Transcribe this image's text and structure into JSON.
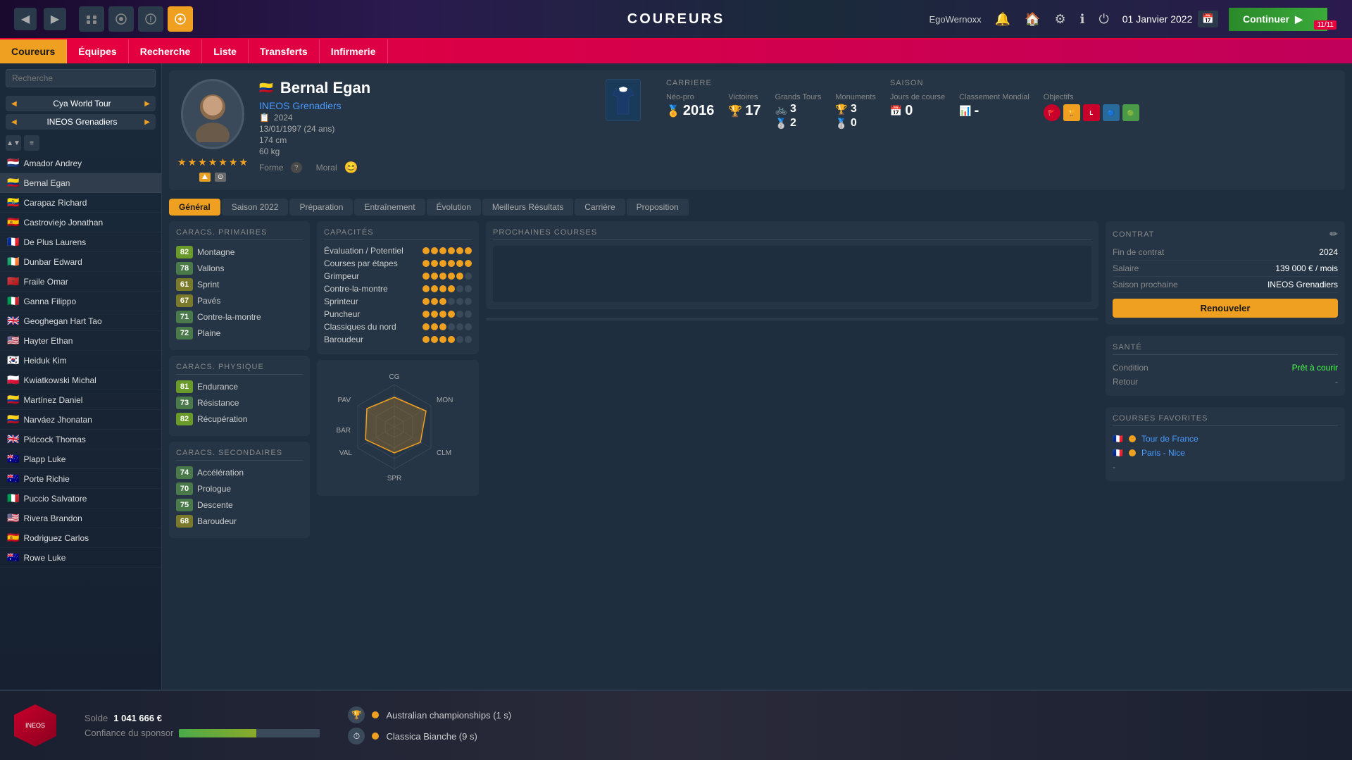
{
  "app": {
    "name": "EgoWernoxx",
    "title": "COUREURS",
    "date": "01 Janvier 2022",
    "continue_label": "Continuer",
    "corner_badge": "11/11"
  },
  "nav_tabs": [
    {
      "id": "coureurs",
      "label": "Coureurs",
      "active": true
    },
    {
      "id": "equipes",
      "label": "Équipes",
      "active": false
    },
    {
      "id": "recherche",
      "label": "Recherche",
      "active": false
    },
    {
      "id": "liste",
      "label": "Liste",
      "active": false
    },
    {
      "id": "transferts",
      "label": "Transferts",
      "active": false
    },
    {
      "id": "infirmerie",
      "label": "Infirmerie",
      "active": false
    }
  ],
  "sidebar": {
    "search_placeholder": "Recherche",
    "filters": [
      {
        "label": "Cya World Tour"
      },
      {
        "label": "INEOS Grenadiers"
      }
    ],
    "riders": [
      {
        "flag": "🇳🇱",
        "name": "Amador Andrey"
      },
      {
        "flag": "🇨🇴",
        "name": "Bernal Egan",
        "active": true
      },
      {
        "flag": "🇪🇨",
        "name": "Carapaz Richard"
      },
      {
        "flag": "🇪🇸",
        "name": "Castroviejo Jonathan"
      },
      {
        "flag": "🇫🇷",
        "name": "De Plus Laurens"
      },
      {
        "flag": "🇮🇪",
        "name": "Dunbar Edward"
      },
      {
        "flag": "🇲🇦",
        "name": "Fraile Omar"
      },
      {
        "flag": "🇮🇹",
        "name": "Ganna Filippo"
      },
      {
        "flag": "🇬🇧",
        "name": "Geoghegan Hart Tao"
      },
      {
        "flag": "🇺🇸",
        "name": "Hayter Ethan"
      },
      {
        "flag": "🇰🇷",
        "name": "Heiduk Kim"
      },
      {
        "flag": "🇵🇱",
        "name": "Kwiatkowski Michal"
      },
      {
        "flag": "🇨🇴",
        "name": "Martínez Daniel"
      },
      {
        "flag": "🇨🇴",
        "name": "Narváez Jhonatan"
      },
      {
        "flag": "🇬🇧",
        "name": "Pidcock Thomas"
      },
      {
        "flag": "🇦🇺",
        "name": "Plapp Luke"
      },
      {
        "flag": "🇦🇺",
        "name": "Porte Richie"
      },
      {
        "flag": "🇮🇹",
        "name": "Puccio Salvatore"
      },
      {
        "flag": "🇺🇸",
        "name": "Rivera Brandon"
      },
      {
        "flag": "🇪🇸",
        "name": "Rodriguez Carlos"
      },
      {
        "flag": "🇦🇺",
        "name": "Rowe Luke"
      }
    ]
  },
  "player": {
    "name": "Bernal Egan",
    "flag": "🇨🇴",
    "team": "INEOS Grenadiers",
    "contract_year": "2024",
    "birthdate": "13/01/1997 (24 ans)",
    "height": "174 cm",
    "weight": "60 kg",
    "form_label": "Forme",
    "form_value": "?",
    "moral_label": "Moral",
    "stars": 7,
    "section_tabs": [
      {
        "label": "Général",
        "active": true
      },
      {
        "label": "Saison 2022"
      },
      {
        "label": "Préparation"
      },
      {
        "label": "Entraînement"
      },
      {
        "label": "Évolution"
      },
      {
        "label": "Meilleurs Résultats"
      },
      {
        "label": "Carrière"
      },
      {
        "label": "Proposition"
      }
    ]
  },
  "career": {
    "title": "CARRIERE",
    "neopro_label": "Néo-pro",
    "neopro_year": "2016",
    "victories_label": "Victoires",
    "victories": "17",
    "grands_tours_label": "Grands Tours",
    "grands_tours_1": "3",
    "grands_tours_2": "2",
    "monuments_label": "Monuments",
    "monuments_1": "3",
    "monuments_2": "0"
  },
  "season": {
    "title": "SAISON",
    "jours_label": "Jours de course",
    "jours_value": "0",
    "classement_label": "Classement Mondial",
    "classement_value": "-",
    "objectifs_label": "Objectifs"
  },
  "stats": {
    "primaires_title": "CARACS. PRIMAIRES",
    "primaires": [
      {
        "value": "82",
        "label": "Montagne",
        "level": "high"
      },
      {
        "value": "78",
        "label": "Vallons",
        "level": "high"
      },
      {
        "value": "61",
        "label": "Sprint",
        "level": "med"
      },
      {
        "value": "67",
        "label": "Pavés",
        "level": "med"
      },
      {
        "value": "71",
        "label": "Contre-la-montre",
        "level": "med"
      },
      {
        "value": "72",
        "label": "Plaine",
        "level": "med"
      }
    ],
    "physique_title": "CARACS. PHYSIQUE",
    "physique": [
      {
        "value": "81",
        "label": "Endurance",
        "level": "high"
      },
      {
        "value": "73",
        "label": "Résistance",
        "level": "med"
      },
      {
        "value": "82",
        "label": "Récupération",
        "level": "high"
      }
    ],
    "secondaires_title": "CARACS. SECONDAIRES",
    "secondaires": [
      {
        "value": "74",
        "label": "Accélération",
        "level": "med"
      },
      {
        "value": "70",
        "label": "Prologue",
        "level": "med"
      },
      {
        "value": "75",
        "label": "Descente",
        "level": "med"
      },
      {
        "value": "68",
        "label": "Baroudeur",
        "level": "med"
      }
    ]
  },
  "capacites": {
    "title": "CAPACITÉS",
    "items": [
      {
        "label": "Évaluation / Potentiel",
        "dots": 6,
        "filled": 6
      },
      {
        "label": "Courses par étapes",
        "dots": 6,
        "filled": 6
      },
      {
        "label": "Grimpeur",
        "dots": 6,
        "filled": 5
      },
      {
        "label": "Contre-la-montre",
        "dots": 6,
        "filled": 4
      },
      {
        "label": "Sprinteur",
        "dots": 6,
        "filled": 3
      },
      {
        "label": "Puncheur",
        "dots": 6,
        "filled": 4
      },
      {
        "label": "Classiques du nord",
        "dots": 6,
        "filled": 3
      },
      {
        "label": "Baroudeur",
        "dots": 6,
        "filled": 4
      }
    ]
  },
  "radar": {
    "labels": [
      "CG",
      "MON",
      "CLM",
      "SPR",
      "VAL",
      "PAV",
      "BAR"
    ],
    "values": [
      0.7,
      0.82,
      0.71,
      0.61,
      0.78,
      0.67,
      0.62
    ]
  },
  "prochaines_courses": {
    "title": "PROCHAINES COURSES"
  },
  "contract": {
    "title": "CONTRAT",
    "fin_label": "Fin de contrat",
    "fin_value": "2024",
    "salaire_label": "Salaire",
    "salaire_value": "139 000 € / mois",
    "saison_label": "Saison prochaine",
    "saison_value": "INEOS Grenadiers",
    "renew_label": "Renouveler"
  },
  "sante": {
    "title": "SANTÉ",
    "condition_label": "Condition",
    "condition_value": "Prêt à courir",
    "retour_label": "Retour",
    "retour_value": "-"
  },
  "courses_favorites": {
    "title": "COURSES FAVORITES",
    "items": [
      {
        "flag": "🇫🇷",
        "dot_color": "#f0a020",
        "name": "Tour de France"
      },
      {
        "flag": "🇫🇷",
        "dot_color": "#f0a020",
        "name": "Paris - Nice"
      },
      {
        "name": "-"
      }
    ]
  },
  "bottom": {
    "solde_label": "Solde",
    "solde_value": "1 041 666 €",
    "sponsor_label": "Confiance du sponsor",
    "races": [
      {
        "icon": "🏆",
        "badge_color": "#f0a020",
        "text": "Australian championships (1 s)"
      },
      {
        "icon": "⏱",
        "badge_color": "#f0a020",
        "text": "Classica Bianche (9 s)"
      }
    ]
  }
}
